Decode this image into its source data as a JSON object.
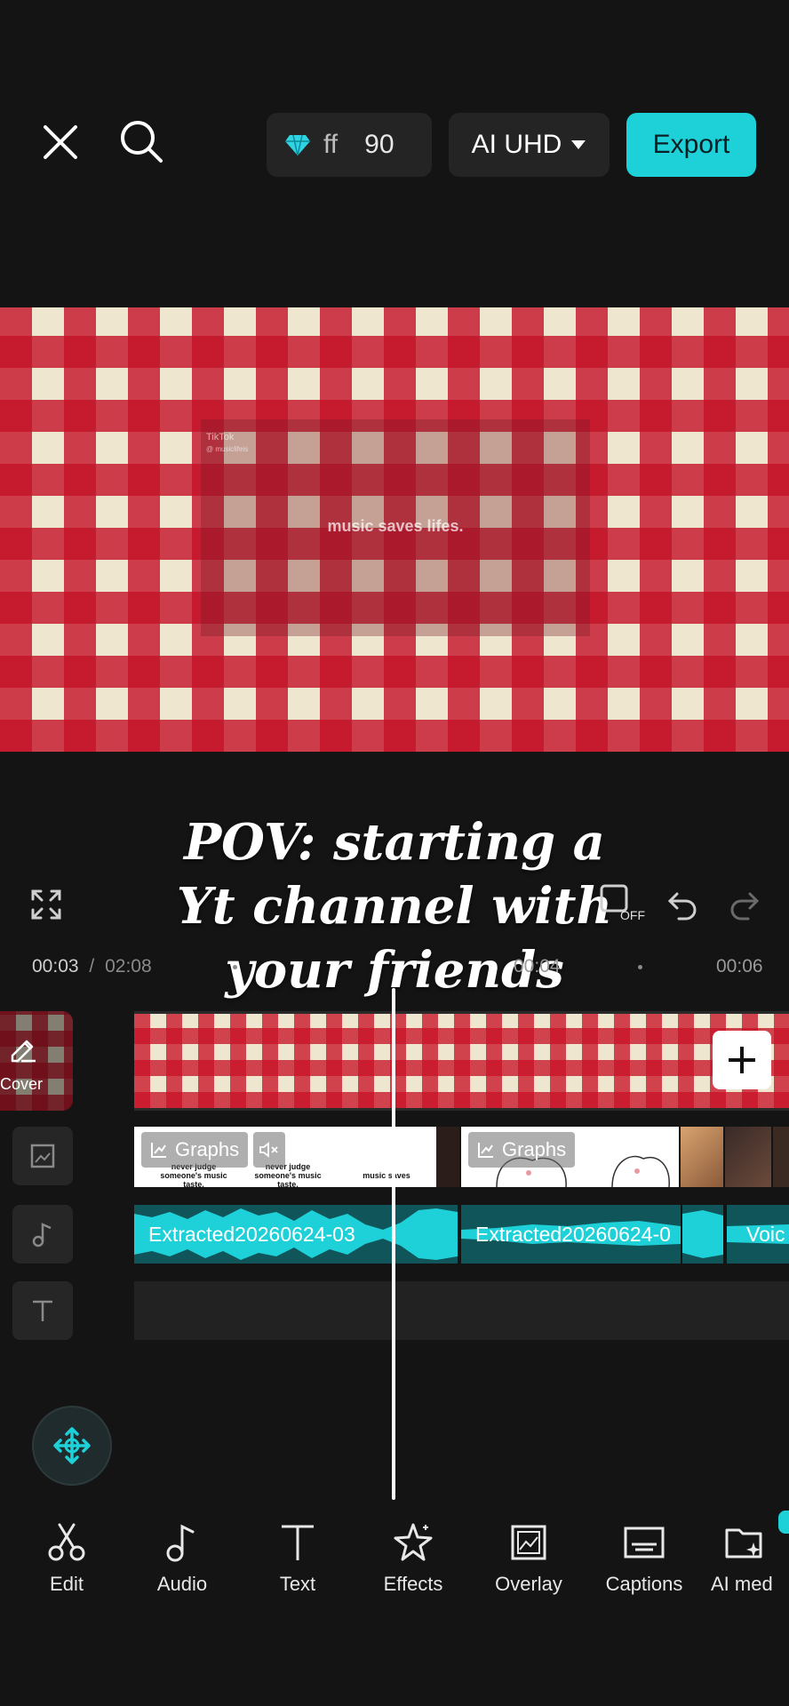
{
  "topbar": {
    "close_icon": "close-icon",
    "search_icon": "search-icon",
    "pro_label": "ff",
    "pro_count": "90",
    "quality_label": "AI UHD",
    "export_label": "Export"
  },
  "preview": {
    "watermark_top": "TikTok",
    "watermark_handle": "@ musiclifeis",
    "inner_text": "music saves lifes.",
    "caption": "POV: starting a Yt channel with your friends"
  },
  "controls": {
    "fullscreen_icon": "fullscreen-icon",
    "keyframe_off_label": "OFF",
    "undo_icon": "undo-icon",
    "redo_icon": "redo-icon"
  },
  "timeline": {
    "current_time": "00:03",
    "separator": "/",
    "total_time": "02:08",
    "tick_1": "00:04",
    "tick_2": "00:06",
    "cover_label": "Cover",
    "overlay_clip_1": "Graphs",
    "overlay_clip_2": "Graphs",
    "overlay_thumb_text_1": "never judge someone's music taste.",
    "overlay_thumb_text_2": "never judge someone's music taste.",
    "overlay_thumb_text_3": "music saves",
    "audio_clip_1": "Extracted20260624-03",
    "audio_clip_2": "Extracted20260624-0",
    "audio_clip_3": "Voic"
  },
  "toolbar": {
    "items": [
      {
        "label": "Edit",
        "icon": "scissors-icon"
      },
      {
        "label": "Audio",
        "icon": "music-note-icon"
      },
      {
        "label": "Text",
        "icon": "text-icon"
      },
      {
        "label": "Effects",
        "icon": "effects-star-icon"
      },
      {
        "label": "Overlay",
        "icon": "overlay-icon"
      },
      {
        "label": "Captions",
        "icon": "captions-icon"
      },
      {
        "label": "AI med",
        "icon": "ai-media-icon"
      }
    ]
  },
  "colors": {
    "accent": "#1ed1d9",
    "background": "#141414",
    "audio_clip": "#0f5559"
  }
}
